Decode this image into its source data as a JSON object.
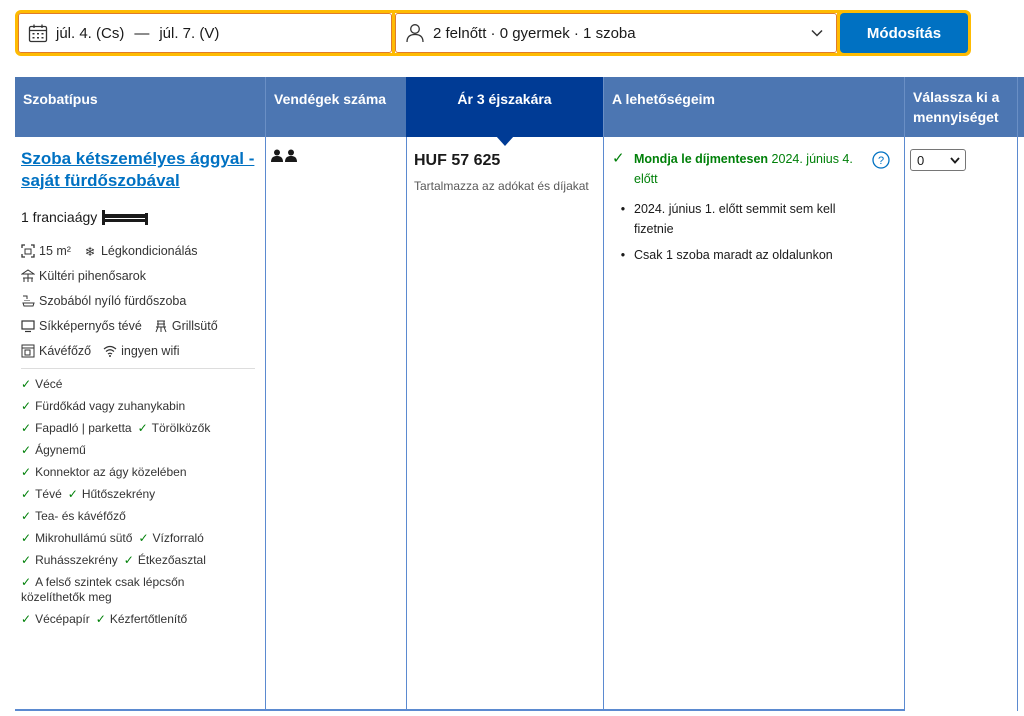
{
  "search": {
    "check_in": "júl. 4. (Cs)",
    "dash": "—",
    "check_out": "júl. 7. (V)",
    "guests": "2 felnőtt · 0 gyermek · 1 szoba",
    "modify_label": "Módosítás"
  },
  "table": {
    "headers": {
      "room_type": "Szobatípus",
      "guests": "Vendégek száma",
      "price": "Ár 3 éjszakára",
      "options": "A lehetőségeim",
      "quantity": "Válassza ki a mennyiséget"
    }
  },
  "room": {
    "title": "Szoba kétszemélyes ággyal - saját fürdőszobával",
    "bed": "1 franciaágy",
    "facilities": {
      "size": "15 m²",
      "ac": "Légkondicionálás",
      "patio": "Kültéri pihenősarok",
      "ensuite": "Szobából nyíló fürdőszoba",
      "tv": "Síkképernyős tévé",
      "grill": "Grillsütő",
      "coffee": "Kávéfőző",
      "wifi": "ingyen wifi"
    },
    "amenities": {
      "a1": "Vécé",
      "a2": "Fürdőkád vagy zuhanykabin",
      "a3": "Fapadló | parketta",
      "a4": "Törölközők",
      "a5": "Ágynemű",
      "a6": "Konnektor az ágy közelében",
      "a7": "Tévé",
      "a8": "Hűtőszekrény",
      "a9": "Tea- és kávéfőző",
      "a10": "Mikrohullámú sütő",
      "a11": "Vízforraló",
      "a12": "Ruhásszekrény",
      "a13": "Étkezőasztal",
      "a14": "A felső szintek csak lépcsőn közelíthetők meg",
      "a15": "Vécépapír",
      "a16": "Kézfertőtlenítő"
    }
  },
  "price": {
    "amount": "HUF 57 625",
    "note": "Tartalmazza az adókat és díjakat"
  },
  "options": {
    "free_cancel_bold": "Mondja le díjmentesen",
    "free_cancel_rest": " 2024. június 4. előtt",
    "pay_later": "2024. június 1. előtt semmit sem kell fizetnie",
    "last_room": "Csak 1 szoba maradt az oldalunkon"
  },
  "quantity": {
    "selected": "0"
  },
  "colors": {
    "header": "#4c76b2",
    "header_active": "#003b95",
    "link": "#0071c2",
    "accent": "#febb02",
    "success": "#008009"
  }
}
